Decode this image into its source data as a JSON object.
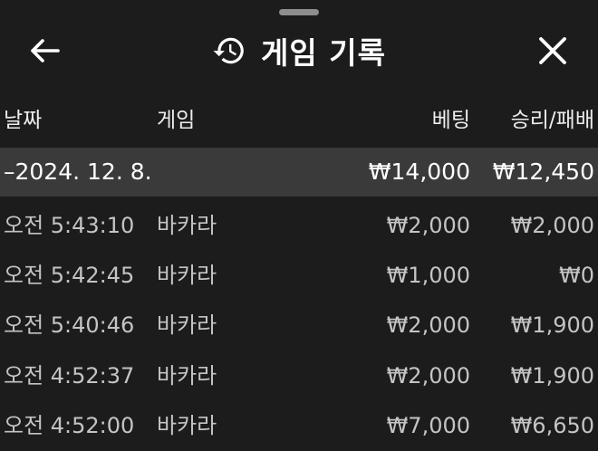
{
  "header": {
    "title": "게임 기록",
    "back_icon": "arrow-left-icon",
    "history_icon": "history-icon",
    "close_icon": "close-icon"
  },
  "columns": {
    "date": "날짜",
    "game": "게임",
    "bet": "베팅",
    "result": "승리/패배"
  },
  "group": {
    "date": "–2024. 12. 8.",
    "bet_total": "₩14,000",
    "result_total": "₩12,450"
  },
  "rows": [
    {
      "time": "오전 5:43:10",
      "game": "바카라",
      "bet": "₩2,000",
      "result": "₩2,000"
    },
    {
      "time": "오전 5:42:45",
      "game": "바카라",
      "bet": "₩1,000",
      "result": "₩0"
    },
    {
      "time": "오전 5:40:46",
      "game": "바카라",
      "bet": "₩2,000",
      "result": "₩1,900"
    },
    {
      "time": "오전 4:52:37",
      "game": "바카라",
      "bet": "₩2,000",
      "result": "₩1,900"
    },
    {
      "time": "오전 4:52:00",
      "game": "바카라",
      "bet": "₩7,000",
      "result": "₩6,650"
    }
  ],
  "colors": {
    "background": "#1c1c1c",
    "group_row": "#3a3a3a",
    "text_primary": "#ffffff",
    "text_secondary": "#c4c4c4"
  }
}
